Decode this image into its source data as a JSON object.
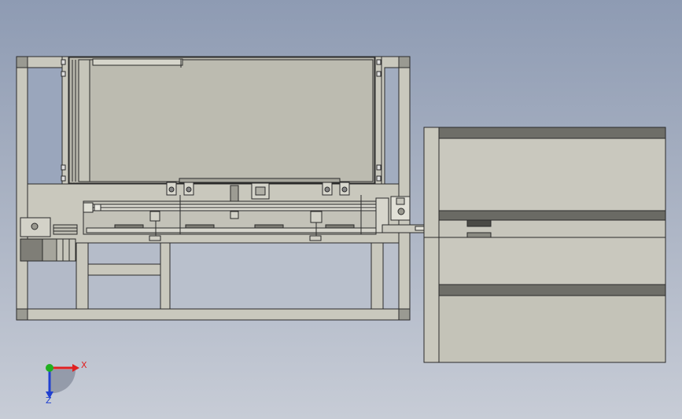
{
  "viewport": {
    "background_top": "#8e9bb3",
    "background_bottom": "#c7ccd6"
  },
  "model": {
    "frame_fill": "#c9c8bd",
    "panel_fill": "#b9b8ad",
    "edge_color": "#2a2a2a",
    "dark_band": "#6e6e68"
  },
  "triad": {
    "x_label": "X",
    "z_label": "Z",
    "x_color": "#e02020",
    "y_color": "#20b020",
    "z_color": "#2040d0"
  }
}
